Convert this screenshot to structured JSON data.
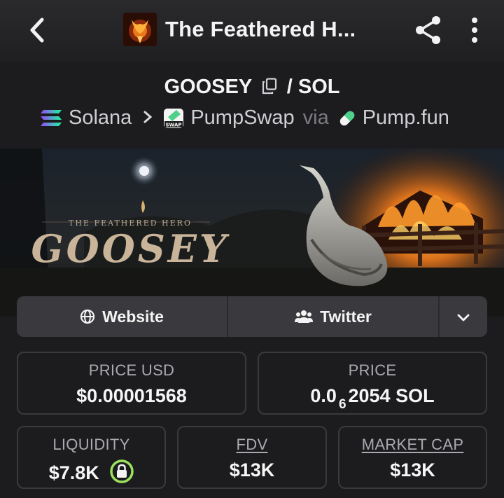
{
  "header": {
    "title": "The Feathered H...",
    "back_icon": "back-chevron-icon",
    "share_icon": "share-icon",
    "more_icon": "more-vertical-icon"
  },
  "pair": {
    "base": "GOOSEY",
    "separator": "/",
    "quote": "SOL"
  },
  "chain": {
    "network": "Solana",
    "dex": "PumpSwap",
    "via": "via",
    "launchpad": "Pump.fun"
  },
  "banner": {
    "tagline": "THE FEATHERED HERO",
    "name": "GOOSEY"
  },
  "links": {
    "website": "Website",
    "twitter": "Twitter"
  },
  "stats": {
    "price_usd": {
      "label": "PRICE USD",
      "value": "$0.00001568"
    },
    "price": {
      "label": "PRICE",
      "prefix": "0.0",
      "zeros": "6",
      "suffix": "2054 SOL"
    },
    "liquidity": {
      "label": "LIQUIDITY",
      "value": "$7.8K"
    },
    "fdv": {
      "label": "FDV",
      "value": "$13K"
    },
    "market_cap": {
      "label": "MARKET CAP",
      "value": "$13K"
    }
  },
  "colors": {
    "background": "#1c1c1f",
    "card_border": "#3a3a3e",
    "link_bar": "#3a3a3e",
    "lock_green": "#9be15d"
  }
}
